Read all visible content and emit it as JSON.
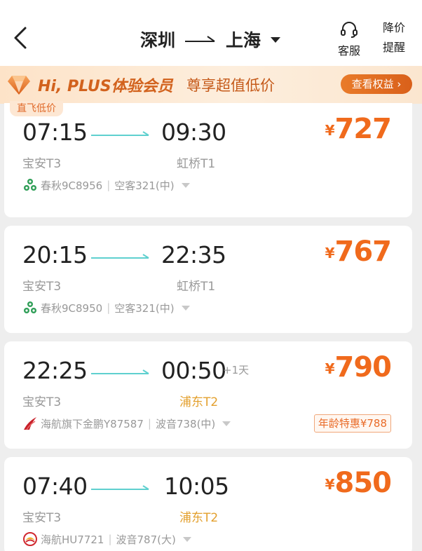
{
  "header": {
    "from_city": "深圳",
    "to_city": "上海",
    "service_label": "客服",
    "alert_label_1": "降价",
    "alert_label_2": "提醒"
  },
  "plus_banner": {
    "title": "Hi, PLUS体验会员",
    "slogan": "尊享超值低价",
    "button": "查看权益",
    "button_arrow": "›"
  },
  "currency": "¥",
  "flights": [
    {
      "tag": "直飞低价",
      "dep_time": "07:15",
      "arr_time": "09:30",
      "day_offset": "",
      "dep_airport": "宝安T3",
      "arr_airport": "虹桥T1",
      "airline": "春秋9C8956",
      "aircraft": "空客321(中)",
      "price": "727",
      "promo": "",
      "logo": "spring-airlines-logo"
    },
    {
      "tag": "",
      "dep_time": "20:15",
      "arr_time": "22:35",
      "day_offset": "",
      "dep_airport": "宝安T3",
      "arr_airport": "虹桥T1",
      "airline": "春秋9C8950",
      "aircraft": "空客321(中)",
      "price": "767",
      "promo": "",
      "logo": "spring-airlines-logo"
    },
    {
      "tag": "",
      "dep_time": "22:25",
      "arr_time": "00:50",
      "day_offset": "+1天",
      "dep_airport": "宝安T3",
      "arr_airport": "浦东T2",
      "airline": "海航旗下金鹏Y87587",
      "aircraft": "波音738(中)",
      "price": "790",
      "promo": "年龄特惠¥788",
      "logo": "suparna-airlines-logo"
    },
    {
      "tag": "",
      "dep_time": "07:40",
      "arr_time": "10:05",
      "day_offset": "",
      "dep_airport": "宝安T3",
      "arr_airport": "浦东T2",
      "airline": "海航HU7721",
      "aircraft": "波音787(大)",
      "price": "850",
      "promo": "",
      "logo": "hainan-airlines-logo"
    }
  ],
  "colors": {
    "price": "#f06a1c",
    "highlight_airport": "#e3a02e",
    "line_gradient": "#5fd0cf"
  }
}
